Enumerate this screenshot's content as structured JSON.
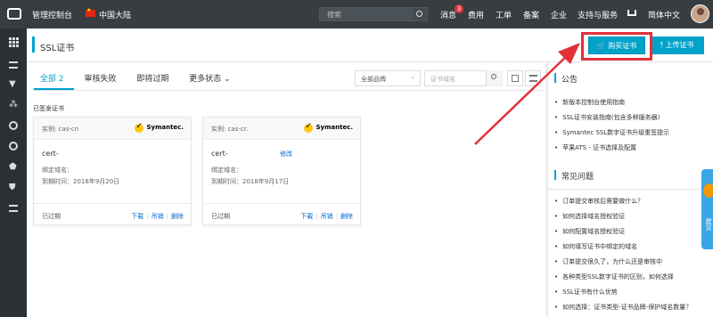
{
  "topbar": {
    "console": "管理控制台",
    "region": "中国大陆",
    "search_placeholder": "搜索",
    "nav": [
      {
        "id": "messages",
        "label": "消息",
        "badge": "3"
      },
      {
        "id": "billing",
        "label": "费用"
      },
      {
        "id": "ticket",
        "label": "工单"
      },
      {
        "id": "icp",
        "label": "备案"
      },
      {
        "id": "enterprise",
        "label": "企业"
      },
      {
        "id": "support",
        "label": "支持与服务"
      },
      {
        "id": "language",
        "label": "简体中文"
      }
    ]
  },
  "header": {
    "title": "SSL证书",
    "buy_button": "购买证书",
    "upload_button": "上传证书"
  },
  "tabs": [
    {
      "label": "全部",
      "count": "2",
      "active": true
    },
    {
      "label": "审核失败"
    },
    {
      "label": "即将过期"
    },
    {
      "label": "更多状态"
    }
  ],
  "filters": {
    "brand": "全部品牌",
    "domain_placeholder": "证书域名"
  },
  "section_label": "已签发证书",
  "cards": [
    {
      "instance": "实例: cas-cn",
      "brand": "Symantec.",
      "name": "cert-",
      "domain_label": "绑定域名：",
      "expiry_label": "到期时间：",
      "expiry_date": "2018年9月20日",
      "status": "已过期",
      "actions": [
        "下载",
        "吊销",
        "删除"
      ]
    },
    {
      "instance": "实例: cas-cr.",
      "brand": "Symantec.",
      "name": "cert-",
      "modify": "修改",
      "domain_label": "绑定域名：",
      "expiry_label": "到期时间：",
      "expiry_date": "2018年9月17日",
      "status": "已过期",
      "actions": [
        "下载",
        "吊销",
        "删除"
      ]
    }
  ],
  "announcements": {
    "title": "公告",
    "items": [
      "新版本控制台使用指南",
      "SSL证书安装指南(包含多种服务器)",
      "Symantec SSL数字证书升级重签提示",
      "苹果ATS - 证书选择及配置"
    ]
  },
  "faq": {
    "title": "常见问题",
    "items": [
      "订单提交审核后需要做什么？",
      "如何选择域名授权验证",
      "如何配置域名授权验证",
      "如何填写证书中绑定的域名",
      "订单提交很久了，为什么还是审核中",
      "各种类型SSL数字证书的区别，如何选择",
      "SSL证书有什么优势",
      "如何选择：证书类型-证书品牌-保护域名数量？"
    ]
  },
  "float_tab": {
    "label": "建议"
  },
  "colors": {
    "accent": "#00a2ca",
    "topbar": "#373d41",
    "sidebar": "#2b3035",
    "highlight": "#e33038"
  }
}
